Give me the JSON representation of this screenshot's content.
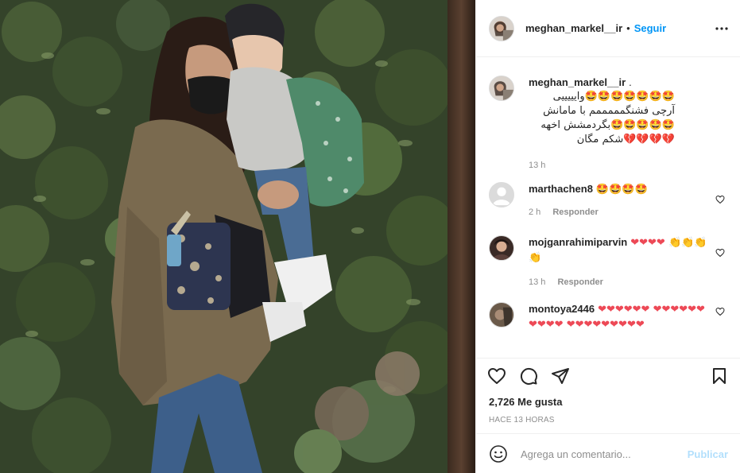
{
  "post": {
    "photo_alt": "",
    "author": {
      "username": "meghan_markel__ir",
      "follow_label": "Seguir",
      "separator": "•"
    },
    "caption": {
      "username": "meghan_markel__ir",
      "dot": ".",
      "lines": [
        "🤩🤩🤩🤩🤩🤩🤩وایییییی",
        "آرچی فشنگمممممم با مامانش",
        "🤩🤩🤩🤩🤩بگردمشش اخهه",
        "💔💔💔💔شکم مگان"
      ],
      "time": "13 h"
    },
    "comments": [
      {
        "username": "marthachen8",
        "text": "🤩🤩🤩🤩",
        "time": "2 h",
        "reply_label": "Responder"
      },
      {
        "username": "mojganrahimiparvin",
        "text": "❤❤❤❤ 👏👏👏👏",
        "time": "13 h",
        "reply_label": "Responder"
      },
      {
        "username": "montoya2446",
        "text": "❤❤❤❤❤❤ ❤❤❤❤❤❤❤❤❤❤ ❤❤❤❤❤❤❤❤❤",
        "time": "",
        "reply_label": ""
      }
    ],
    "likes_label": "2,726 Me gusta",
    "time_ago": "HACE 13 HORAS",
    "add_comment": {
      "placeholder": "Agrega un comentario...",
      "publish_label": "Publicar"
    },
    "colors": {
      "link_blue": "#0095f6",
      "publish_disabled": "#b2dffc",
      "meta_grey": "#8e8e8e",
      "heart_red": "#ed4956"
    },
    "icons": {
      "more": "more-options-icon",
      "like": "heart-outline-icon",
      "comment": "comment-bubble-icon",
      "share": "paper-plane-icon",
      "save": "bookmark-icon",
      "emoji": "smiley-icon",
      "comment_like": "small-heart-icon"
    }
  }
}
